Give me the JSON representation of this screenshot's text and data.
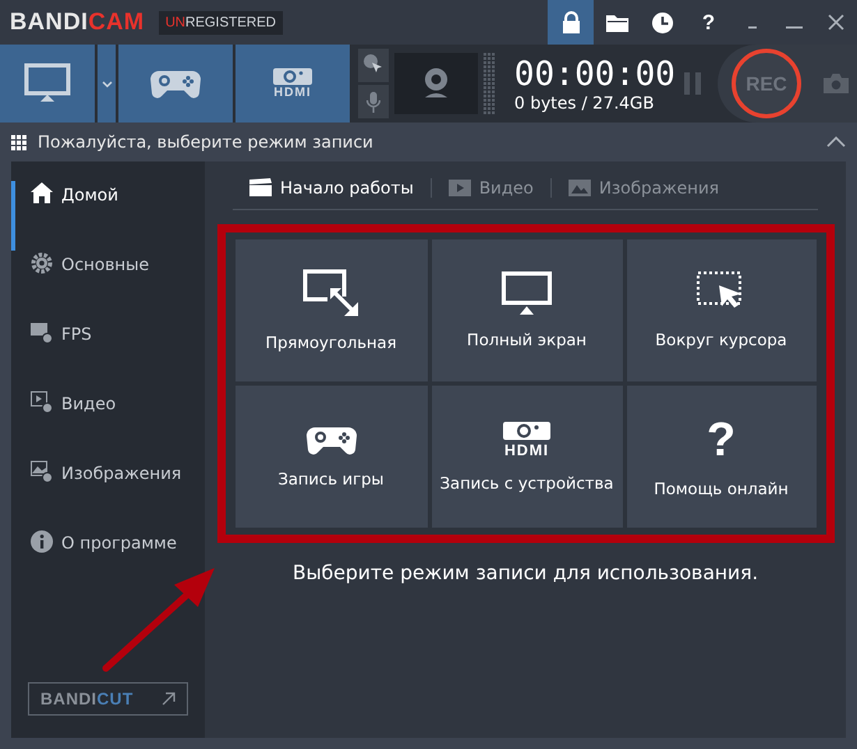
{
  "titlebar": {
    "logo": {
      "main": "BANDI",
      "accent": "CAM"
    },
    "badge": {
      "accent": "UN",
      "main": "REGISTERED"
    },
    "buttons": [
      {
        "kind": "lock",
        "selected": true
      },
      {
        "kind": "folder",
        "selected": false
      },
      {
        "kind": "clock",
        "selected": false
      },
      {
        "kind": "help",
        "glyph": "?",
        "selected": false
      }
    ]
  },
  "toolbar": {
    "modes": [
      {
        "kind": "screen",
        "selected": true
      },
      {
        "kind": "game",
        "selected": true
      },
      {
        "kind": "device",
        "label": "HDMI",
        "selected": true
      }
    ],
    "timer": "00:00:00",
    "size": "0 bytes / 27.4GB",
    "rec": "REC"
  },
  "modebar": {
    "title": "Пожалуйста, выберите режим записи"
  },
  "sidebar": {
    "items": [
      {
        "kind": "home",
        "label": "Домой",
        "selected": true
      },
      {
        "kind": "gear",
        "label": "Основные",
        "selected": false
      },
      {
        "kind": "fps",
        "label": "FPS",
        "selected": false
      },
      {
        "kind": "video",
        "label": "Видео",
        "selected": false
      },
      {
        "kind": "image",
        "label": "Изображения",
        "selected": false
      },
      {
        "kind": "info",
        "label": "О программе",
        "selected": false
      }
    ],
    "bandicut": {
      "main": "BANDI",
      "accent": "CUT"
    }
  },
  "tabs": [
    {
      "kind": "clapper",
      "label": "Начало работы",
      "selected": true
    },
    {
      "kind": "play",
      "label": "Видео",
      "selected": false
    },
    {
      "kind": "image",
      "label": "Изображения",
      "selected": false
    }
  ],
  "tiles": [
    {
      "kind": "rectangle",
      "label": "Прямоугольная"
    },
    {
      "kind": "fullscreen",
      "label": "Полный экран"
    },
    {
      "kind": "cursor",
      "label": "Вокруг курсора"
    },
    {
      "kind": "game",
      "label": "Запись игры"
    },
    {
      "kind": "device",
      "label": "Запись с устройства",
      "icon_text": "HDMI"
    },
    {
      "kind": "help",
      "label": "Помощь онлайн",
      "icon_text": "?"
    }
  ],
  "hint": "Выберите режим записи для использования."
}
